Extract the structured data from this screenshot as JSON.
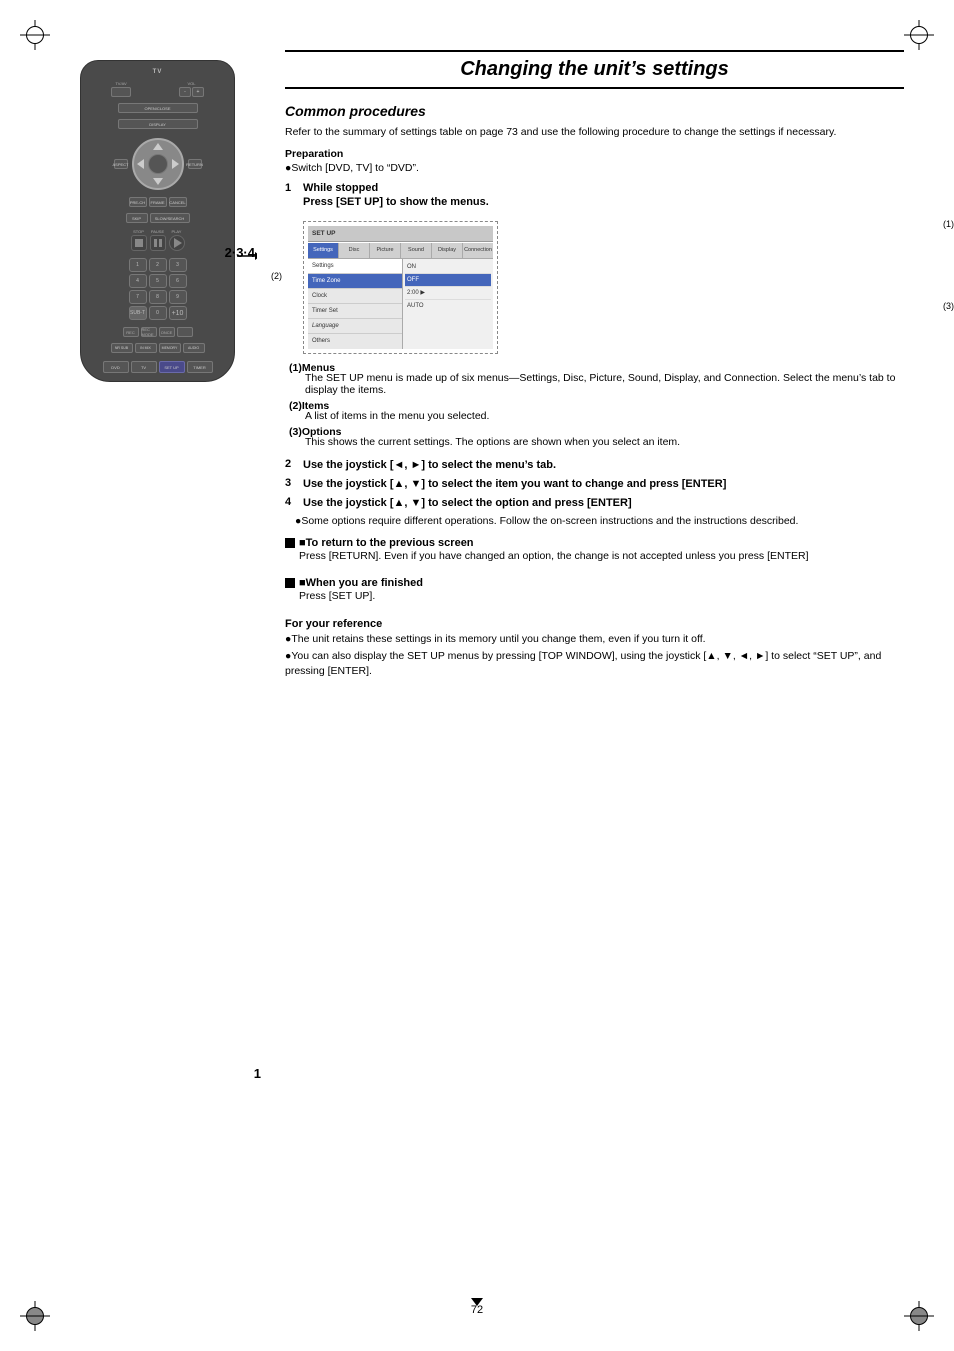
{
  "page": {
    "number": "72",
    "title": "Changing the unit's settings"
  },
  "header": {
    "title": "Changing the unit’s settings"
  },
  "section": {
    "title": "Common procedures",
    "intro": "Refer to the summary of settings table on page 73 and use the following procedure to change the settings if necessary.",
    "prep_label": "Preparation",
    "prep_text": "●Switch [DVD, TV] to “DVD”.",
    "steps": [
      {
        "num": "1",
        "title": "While stopped",
        "desc": "Press [SET UP] to show the menus."
      },
      {
        "num": "2",
        "desc": "Use the joystick [◄, ►] to select the menu’s tab."
      },
      {
        "num": "3",
        "desc": "Use the joystick [▲, ▼] to select the item you want to change and press [ENTER]"
      },
      {
        "num": "4",
        "desc": "Use the joystick [▲, ▼] to select the option and press [ENTER]"
      }
    ],
    "step4_bullet": "●Some options require different  operations. Follow the on-screen instructions and the instructions described.",
    "callouts": [
      {
        "num": "(1)Menus",
        "text": "The SET UP menu is made up of six menus—Settings, Disc, Picture, Sound, Display, and Connection. Select the menu’s tab to display the items."
      },
      {
        "num": "(2)Items",
        "text": "A list of items in the menu you selected."
      },
      {
        "num": "(3)Options",
        "text": "This shows the current settings. The options are shown when you select an item."
      }
    ],
    "return_section": {
      "title": "■To return to the previous screen",
      "text": "Press [RETURN]. Even if you have changed an option, the change is not accepted unless you press [ENTER]"
    },
    "finished_section": {
      "title": "■When you are finished",
      "text": "Press [SET UP]."
    },
    "reference": {
      "title": "For your reference",
      "bullets": [
        "●The unit retains these settings in its memory until you change them, even if you turn it off.",
        "●You can also display the SET UP menus by pressing [TOP WINDOW], using the joystick [▲, ▼, ◄, ►] to select “SET UP”, and pressing [ENTER]."
      ]
    }
  },
  "step_labels": {
    "label_234": "2·3·4",
    "label_1": "1"
  },
  "menu_screen": {
    "tabs": [
      "Settings",
      "Disc",
      "Picture",
      "Sound",
      "Display",
      "Connection"
    ],
    "items": [
      "Settings",
      "Time Zone",
      "Clock",
      "Timer Set",
      "Language",
      "Others"
    ],
    "options": [
      "ON",
      "OFF",
      "2:00",
      "AUTO"
    ]
  }
}
